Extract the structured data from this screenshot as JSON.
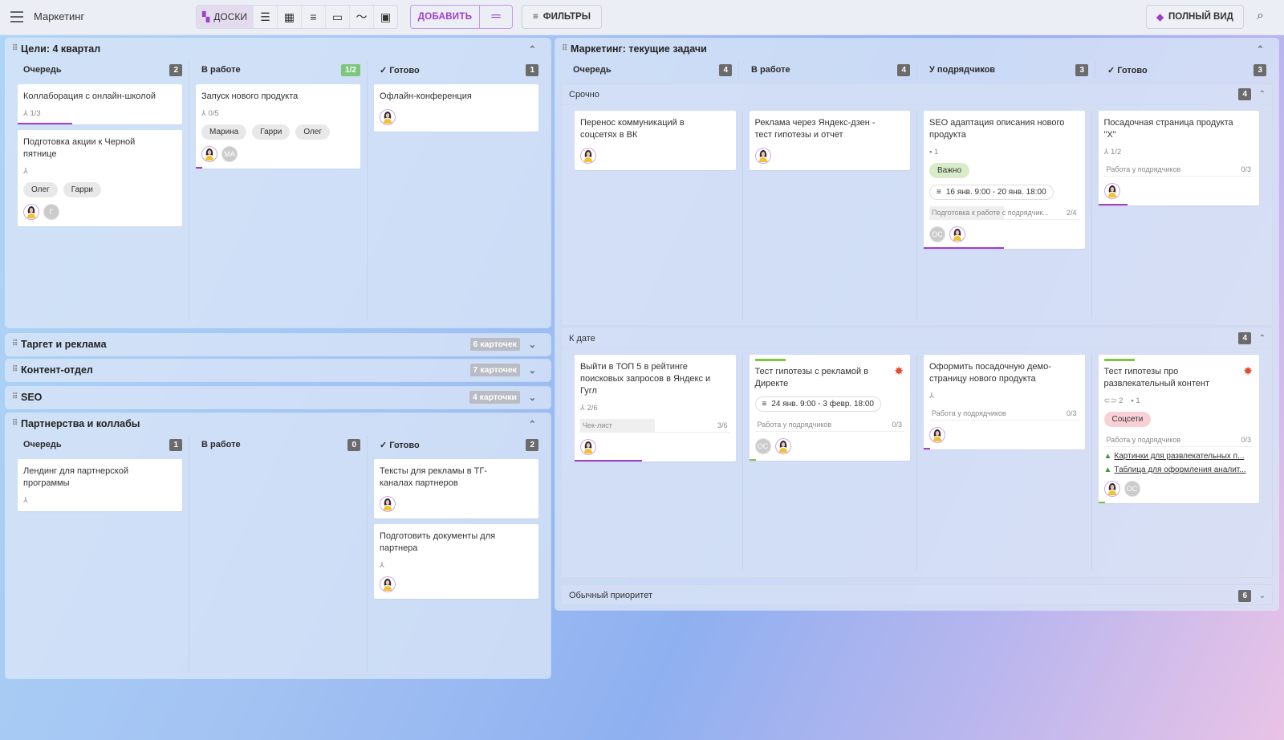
{
  "header": {
    "title": "Маркетинг",
    "views_active": "ДОСКИ",
    "add_label": "ДОБАВИТЬ",
    "filters_label": "ФИЛЬТРЫ",
    "full_view_label": "ПОЛНЫЙ ВИД"
  },
  "colors": {
    "accent": "#a03ec8",
    "progress_purple": "#a23dc6",
    "progress_green": "#82c341"
  },
  "left_boards": [
    {
      "title": "Цели: 4 квартал",
      "expanded": true,
      "columns": [
        {
          "name": "Очередь",
          "count": "2",
          "cards": [
            {
              "title": "Коллаборация с онлайн-школой",
              "subtasks": "1/3",
              "progress": 0.33,
              "pcolor": "purple"
            },
            {
              "title": "Подготовка акции к Черной пятнице",
              "subtasks": "",
              "subicon": true,
              "tags": [
                "Олег",
                "Гарри"
              ],
              "avatars": [
                "photo",
                "Г"
              ]
            }
          ]
        },
        {
          "name": "В работе",
          "count": "1/2",
          "green": true,
          "cards": [
            {
              "title": "Запуск нового продукта",
              "subtasks": "0/5",
              "tags": [
                "Марина",
                "Гарри",
                "Олег"
              ],
              "avatars": [
                "photo",
                "МА"
              ],
              "progress": 0.04,
              "pcolor": "purple"
            }
          ]
        },
        {
          "name": "Готово",
          "count": "1",
          "done": true,
          "cards": [
            {
              "title": "Офлайн-конференция",
              "avatars": [
                "photo"
              ]
            }
          ]
        }
      ]
    },
    {
      "title": "Таргет и реклама",
      "expanded": false,
      "pill": "6 карточек"
    },
    {
      "title": "Контент-отдел",
      "expanded": false,
      "pill": "7 карточек"
    },
    {
      "title": "SEO",
      "expanded": false,
      "pill": "4 карточки"
    },
    {
      "title": "Партнерства и коллабы",
      "expanded": true,
      "columns": [
        {
          "name": "Очередь",
          "count": "1",
          "cards": [
            {
              "title": "Лендинг для партнерской программы",
              "subicon": true
            }
          ]
        },
        {
          "name": "В работе",
          "count": "0",
          "cards": []
        },
        {
          "name": "Готово",
          "count": "2",
          "done": true,
          "cards": [
            {
              "title": "Тексты для рекламы в ТГ-каналах партнеров",
              "avatars": [
                "photo"
              ]
            },
            {
              "title": "Подготовить документы для партнера",
              "subicon": true,
              "avatars": [
                "photo"
              ]
            }
          ]
        }
      ]
    }
  ],
  "right_board": {
    "title": "Маркетинг: текущие задачи",
    "columns": [
      {
        "name": "Очередь",
        "count": "4"
      },
      {
        "name": "В работе",
        "count": "4"
      },
      {
        "name": "У подрядчиков",
        "count": "3"
      },
      {
        "name": "Готово",
        "count": "3",
        "done": true
      }
    ],
    "lanes": [
      {
        "name": "Срочно",
        "count": "4",
        "expanded": true,
        "cols": [
          [
            {
              "title": "Перенос коммуникаций в соцсетях в ВК",
              "avatars": [
                "photo"
              ]
            }
          ],
          [
            {
              "title": "Реклама через Яндекс-дзен - тест гипотезы и отчет",
              "avatars": [
                "photo"
              ]
            }
          ],
          [
            {
              "title": "SEO адаптация описания нового продукта",
              "comments": "1",
              "tagsC": [
                {
                  "label": "Важно",
                  "color": "#d9ecc9"
                }
              ],
              "date": "16 янв. 9:00 - 20 янв. 18:00",
              "checklist": {
                "label": "Подготовка к работе с подрядчик...",
                "value": "2/4",
                "fill": 0.5
              },
              "avatars": [
                "ОС",
                "photo"
              ],
              "progress": 0.5,
              "pcolor": "purple"
            }
          ],
          [
            {
              "title": "Посадочная страница продукта \"X\"",
              "subtasks": "1/2",
              "checklist": {
                "label": "Работа у подрядчиков",
                "value": "0/3",
                "fill": 0
              },
              "avatars": [
                "photo"
              ],
              "progress": 0.18,
              "pcolor": "purple"
            }
          ]
        ]
      },
      {
        "name": "К дате",
        "count": "4",
        "expanded": true,
        "cols": [
          [
            {
              "title": "Выйти в ТОП 5 в рейтинге поисковых запросов в Яндекс и Гугл",
              "subtasks": "2/6",
              "checklist": {
                "label": "Чек-лист",
                "value": "3/6",
                "fill": 0.5
              },
              "avatars": [
                "photo"
              ],
              "progress": 0.42,
              "pcolor": "purple"
            }
          ],
          [
            {
              "title": "Тест гипотезы с рекламой в Директе",
              "greenbar": true,
              "burst": true,
              "date": "24 янв. 9:00 - 3 февр. 18:00",
              "checklist": {
                "label": "Работа у подрядчиков",
                "value": "0/3",
                "fill": 0
              },
              "avatars": [
                "ОС",
                "photo"
              ],
              "progress": 0.04,
              "pcolor": "green"
            }
          ],
          [
            {
              "title": "Оформить посадочную демо-страницу нового продукта",
              "subicon": true,
              "checklist": {
                "label": "Работа у подрядчиков",
                "value": "0/3",
                "fill": 0
              },
              "avatars": [
                "photo"
              ],
              "progress": 0.04,
              "pcolor": "purple"
            }
          ],
          [
            {
              "title": "Тест гипотезы про развлекательный контент",
              "greenbar": true,
              "burst": true,
              "attachments": "2",
              "comments": "1",
              "tagsC": [
                {
                  "label": "Соцсети",
                  "color": "#f9d0d6"
                }
              ],
              "checklist": {
                "label": "Работа у подрядчиков",
                "value": "0/3",
                "fill": 0
              },
              "links": [
                "Картинки для развлекательных п...",
                "Таблица для оформления аналит..."
              ],
              "avatars": [
                "photo",
                "ОС"
              ],
              "progress": 0.04,
              "pcolor": "green"
            }
          ]
        ]
      },
      {
        "name": "Обычный приоритет",
        "count": "6",
        "expanded": false
      }
    ]
  }
}
